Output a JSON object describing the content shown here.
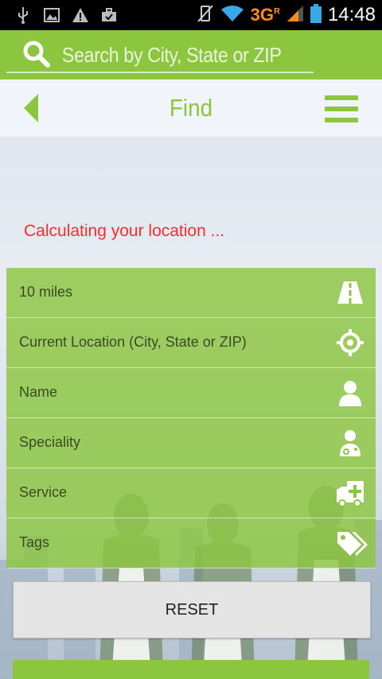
{
  "status_bar": {
    "network": "3G",
    "network_sup": "R",
    "time": "14:48",
    "icons": [
      "usb-icon",
      "image-icon",
      "warning-icon",
      "briefcase-icon",
      "vibrate-icon",
      "wifi-icon",
      "signal-icon",
      "battery-icon"
    ]
  },
  "search": {
    "placeholder": "Search by City, State or ZIP",
    "value": ""
  },
  "header": {
    "title": "Find"
  },
  "location_status": "Calculating your location ...",
  "filters": [
    {
      "label": "10 miles",
      "icon": "road-icon"
    },
    {
      "label": "Current Location (City, State or ZIP)",
      "icon": "crosshair-icon"
    },
    {
      "label": "Name",
      "icon": "person-icon"
    },
    {
      "label": "Speciality",
      "icon": "doctor-icon"
    },
    {
      "label": "Service",
      "icon": "ambulance-icon"
    },
    {
      "label": "Tags",
      "icon": "tags-icon"
    }
  ],
  "reset_label": "RESET",
  "colors": {
    "accent": "#8cc63f",
    "status_text": "#ff2a2a",
    "header_bg": "#f1f4f8"
  }
}
